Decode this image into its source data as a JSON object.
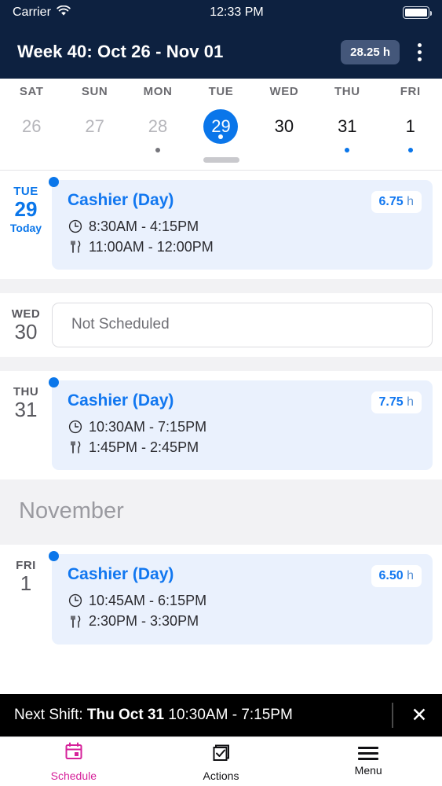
{
  "status_bar": {
    "carrier": "Carrier",
    "wifi_icon": "wifi-icon",
    "time": "12:33 PM",
    "battery_icon": "battery-full-icon"
  },
  "header": {
    "title": "Week 40: Oct 26 - Nov 01",
    "hours_badge": "28.25 h",
    "overflow_icon": "kebab-menu-icon",
    "background": "#0d2140"
  },
  "week_strip": {
    "days": [
      {
        "dow": "SAT",
        "num": "26",
        "selected": false,
        "dimmed": true,
        "dot": "none"
      },
      {
        "dow": "SUN",
        "num": "27",
        "selected": false,
        "dimmed": true,
        "dot": "none"
      },
      {
        "dow": "MON",
        "num": "28",
        "selected": false,
        "dimmed": true,
        "dot": "grey"
      },
      {
        "dow": "TUE",
        "num": "29",
        "selected": true,
        "dimmed": false,
        "dot": "white"
      },
      {
        "dow": "WED",
        "num": "30",
        "selected": false,
        "dimmed": false,
        "dot": "none"
      },
      {
        "dow": "THU",
        "num": "31",
        "selected": false,
        "dimmed": false,
        "dot": "blue"
      },
      {
        "dow": "FRI",
        "num": "1",
        "selected": false,
        "dimmed": false,
        "dot": "blue"
      }
    ],
    "drag_handle": "drag-handle"
  },
  "schedule": {
    "rows": [
      {
        "kind": "shift",
        "dow": "TUE",
        "num": "29",
        "today_label": "Today",
        "is_today": true,
        "role": "Cashier (Day)",
        "hours_value": "6.75",
        "hours_unit": "h",
        "shift_time": "8:30AM - 4:15PM",
        "break_time": "11:00AM - 12:00PM"
      },
      {
        "kind": "empty",
        "dow": "WED",
        "num": "30",
        "is_today": false,
        "empty_text": "Not Scheduled"
      },
      {
        "kind": "shift",
        "dow": "THU",
        "num": "31",
        "today_label": "",
        "is_today": false,
        "role": "Cashier (Day)",
        "hours_value": "7.75",
        "hours_unit": "h",
        "shift_time": "10:30AM - 7:15PM",
        "break_time": "1:45PM - 2:45PM"
      },
      {
        "kind": "month",
        "month_label": "November"
      },
      {
        "kind": "shift",
        "dow": "FRI",
        "num": "1",
        "today_label": "",
        "is_today": false,
        "role": "Cashier (Day)",
        "hours_value": "6.50",
        "hours_unit": "h",
        "shift_time": "10:45AM - 6:15PM",
        "break_time": "2:30PM - 3:30PM"
      }
    ],
    "clock_icon": "clock-icon",
    "meal_icon": "fork-knife-icon"
  },
  "next_shift_banner": {
    "prefix": "Next Shift: ",
    "day": "Thu Oct 31",
    "time": " 10:30AM - 7:15PM",
    "close_icon": "close-icon"
  },
  "tab_bar": {
    "tabs": [
      {
        "label": "Schedule",
        "icon": "calendar-icon",
        "active": true
      },
      {
        "label": "Actions",
        "icon": "checkbox-stack-icon",
        "active": false
      },
      {
        "label": "Menu",
        "icon": "hamburger-icon",
        "active": false
      }
    ],
    "active_color": "#d6219a"
  }
}
